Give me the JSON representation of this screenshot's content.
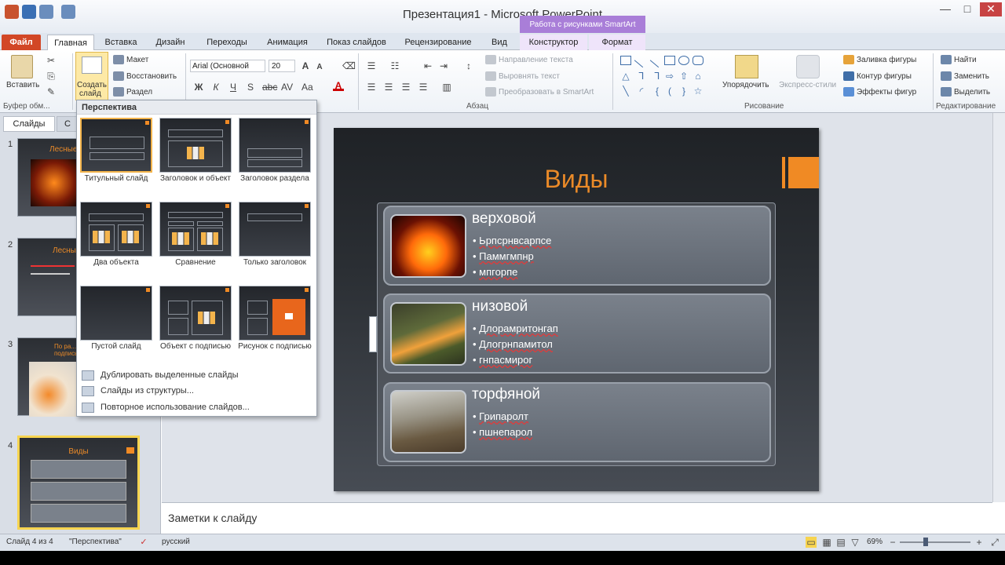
{
  "window": {
    "title": "Презентация1 - Microsoft PowerPoint",
    "context_group": "Работа с рисунками SmartArt",
    "min": "—",
    "max": "□",
    "close": "✕"
  },
  "tabs": {
    "file": "Файл",
    "home": "Главная",
    "insert": "Вставка",
    "design": "Дизайн",
    "transitions": "Переходы",
    "animations": "Анимация",
    "slideshow": "Показ слайдов",
    "review": "Рецензирование",
    "view": "Вид",
    "constructor": "Конструктор",
    "format": "Формат"
  },
  "ribbon": {
    "paste": "Вставить",
    "clipboard_group": "Буфер обм...",
    "new_slide_line1": "Создать",
    "new_slide_line2": "слайд",
    "layout": "Макет",
    "reset": "Восстановить",
    "section": "Раздел",
    "font_name": "Arial (Основной",
    "font_size": "20",
    "text_direction": "Направление текста",
    "align_text": "Выровнять текст",
    "convert_smartart": "Преобразовать в SmartArt",
    "paragraph_group": "Абзац",
    "arrange": "Упорядочить",
    "quick_styles": "Экспресс-стили",
    "drawing_group": "Рисование",
    "shape_fill": "Заливка фигуры",
    "shape_outline": "Контур фигуры",
    "shape_effects": "Эффекты фигур",
    "find": "Найти",
    "replace": "Заменить",
    "select": "Выделить",
    "editing_group": "Редактирование"
  },
  "panel": {
    "tab_slides": "Слайды",
    "tab_outline": "С",
    "thumbs": [
      {
        "num": "1",
        "title": "Лесные"
      },
      {
        "num": "2",
        "title": "Лесные"
      },
      {
        "num": "3",
        "title": "По ра... подписью"
      },
      {
        "num": "4",
        "title": "Виды"
      }
    ]
  },
  "dropdown": {
    "header": "Перспектива",
    "layouts": [
      "Титульный слайд",
      "Заголовок и объект",
      "Заголовок раздела",
      "Два объекта",
      "Сравнение",
      "Только заголовок",
      "Пустой слайд",
      "Объект с подписью",
      "Рисунок с подписью"
    ],
    "menu": [
      "Дублировать выделенные слайды",
      "Слайды из структуры...",
      "Повторное использование слайдов..."
    ]
  },
  "slide": {
    "title": "Виды",
    "rows": [
      {
        "title": "верховой",
        "bullets": [
          "Ьрпсрнвсарпсе",
          "Паммгмпнр",
          "мпгорпе"
        ]
      },
      {
        "title": "низовой",
        "bullets": [
          "Длорамритонгап",
          "Длогрнпамитол",
          "гнпасмирог"
        ]
      },
      {
        "title": "торфяной",
        "bullets": [
          "Грипаролт",
          "пшнепарол"
        ]
      }
    ]
  },
  "notes": {
    "placeholder": "Заметки к слайду"
  },
  "status": {
    "slide_of": "Слайд 4 из 4",
    "theme": "\"Перспектива\"",
    "language": "русский",
    "zoom": "69%"
  },
  "colors": {
    "accent": "#f08a24",
    "file_tab": "#d24726",
    "context_tab": "#a97ed8"
  }
}
